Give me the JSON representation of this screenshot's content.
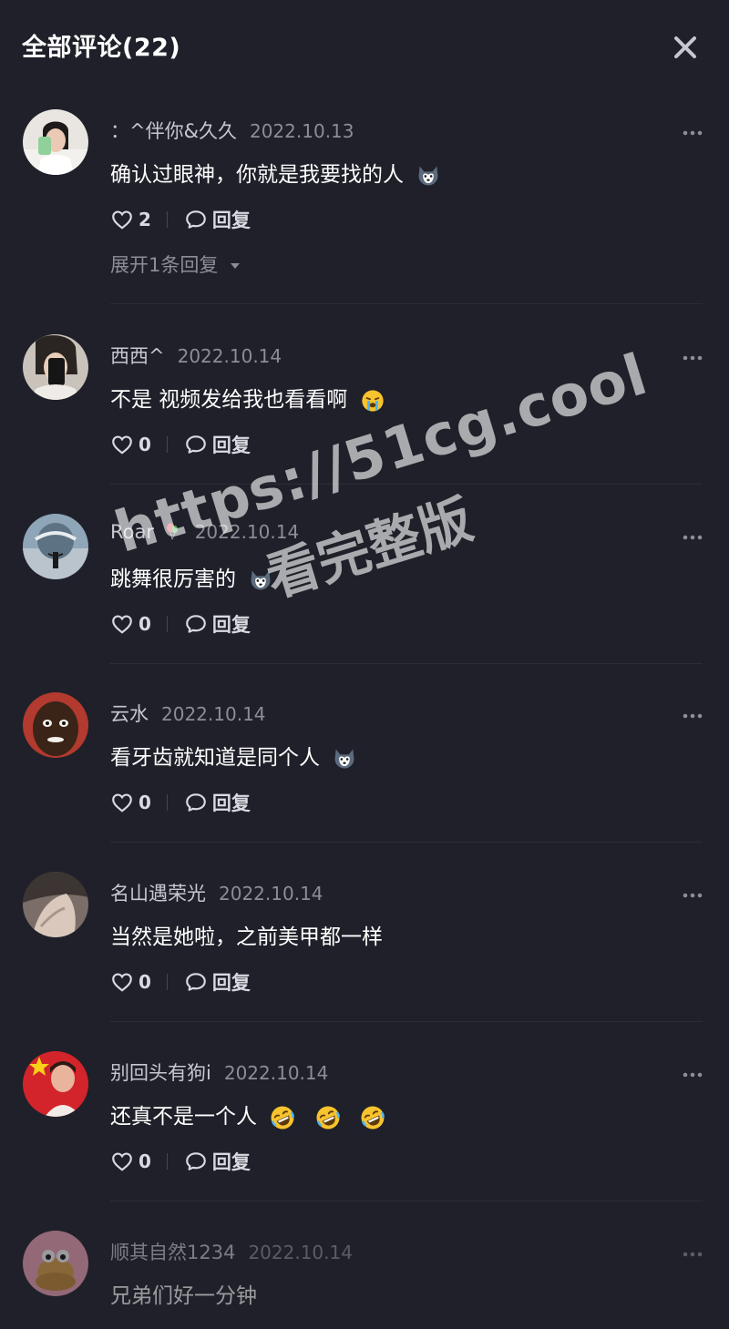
{
  "header": {
    "title": "全部评论(22)"
  },
  "comments": [
    {
      "author": "：^伴你&久久",
      "date": "2022.10.13",
      "text": "确认过眼神，你就是我要找的人",
      "emojis": [
        "husky"
      ],
      "likes": "2",
      "reply_label": "回复",
      "expand_label": "展开1条回复"
    },
    {
      "author": "西西^",
      "date": "2022.10.14",
      "text": "不是 视频发给我也看看啊",
      "emojis": [
        "crying-face"
      ],
      "likes": "0",
      "reply_label": "回复"
    },
    {
      "author": "Roar",
      "date": "2022.10.14",
      "text": "跳舞很厉害的",
      "emojis": [
        "husky"
      ],
      "author_emoji": "balloon",
      "likes": "0",
      "reply_label": "回复"
    },
    {
      "author": "云水",
      "date": "2022.10.14",
      "text": "看牙齿就知道是同个人",
      "emojis": [
        "husky"
      ],
      "likes": "0",
      "reply_label": "回复"
    },
    {
      "author": "名山遇荣光",
      "date": "2022.10.14",
      "text": "当然是她啦，之前美甲都一样",
      "emojis": [],
      "likes": "0",
      "reply_label": "回复"
    },
    {
      "author": "别回头有狗i",
      "date": "2022.10.14",
      "text": "还真不是一个人",
      "emojis": [
        "rofl-face",
        "rofl-face",
        "rofl-face"
      ],
      "likes": "0",
      "reply_label": "回复"
    },
    {
      "author": "顺其自然1234",
      "date": "2022.10.14",
      "text": "兄弟们好一分钟",
      "emojis": []
    }
  ],
  "watermark": {
    "line1": "https://51cg.cool",
    "line2": "看完整版"
  },
  "colors": {
    "background": "#1f2029",
    "secondary_text": "#8c8d95",
    "author_text": "#c7c8ce"
  }
}
